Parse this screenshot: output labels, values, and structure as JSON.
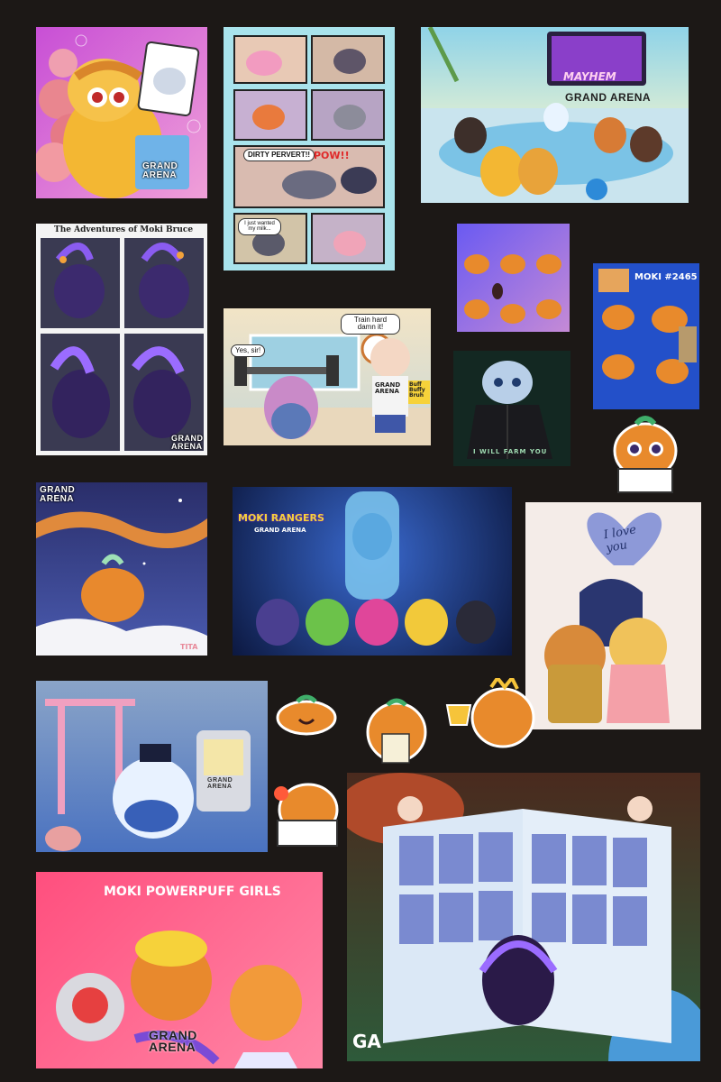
{
  "background_color": "#1c1816",
  "artworks": {
    "gacha_moki": {
      "badge_text": "GRAND ARENA"
    },
    "comic_page": {
      "panel_texts": [
        "DIRTY PERVERT!!",
        "POW!!",
        "I just wanted my milk..."
      ]
    },
    "party_scene": {
      "screen_text": "MAYHEM",
      "badge_text": "GRAND ARENA"
    },
    "moki_bruce": {
      "title": "The Adventures of Moki Bruce",
      "badge_text": "GRAND ARENA"
    },
    "sticker_sheet_purple": {},
    "moki_card_blue": {
      "title": "MOKI #2465"
    },
    "gym_scene": {
      "bubble_left": "Yes, sir!",
      "bubble_right": "Train hard damn it!",
      "sign_text": "Buff Buffy Bruh",
      "shirt_text": "GRAND ARENA"
    },
    "dark_cat": {
      "caption": "I WILL FARM YOU"
    },
    "snow_run": {
      "badge_text": "GRAND ARENA",
      "signature": "TITA"
    },
    "moki_rangers": {
      "title": "MOKI RANGERS",
      "subtitle": "GRAND ARENA"
    },
    "love_scene": {
      "balloon_text": "I love you"
    },
    "torii_scene": {
      "machine_text": "GRAND ARENA"
    },
    "powerpuff": {
      "title": "MOKI POWERPUFF GIRLS",
      "badge_text": "GRAND ARENA"
    },
    "card_book": {
      "badge_text": "GA"
    }
  },
  "colors": {
    "moki_orange": "#e88a2c",
    "moki_leaf": "#3fae6a",
    "grand_arena_purple": "#5b3aa8"
  }
}
